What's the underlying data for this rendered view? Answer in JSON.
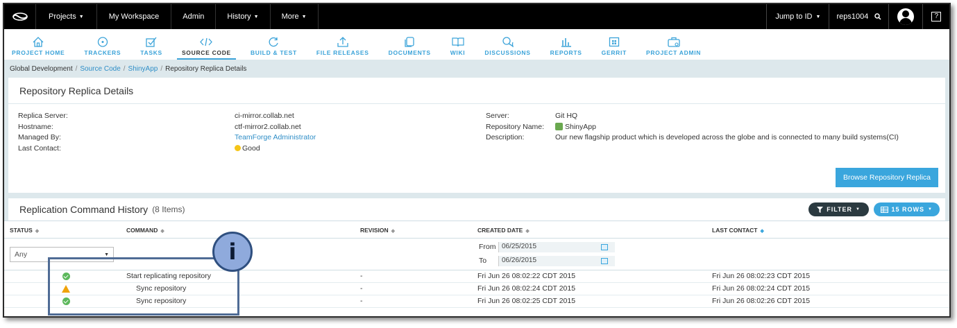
{
  "topbar": {
    "items": [
      "Projects",
      "My Workspace",
      "Admin",
      "History",
      "More"
    ],
    "jump_label": "Jump to ID",
    "search_value": "reps1004",
    "help_label": "?",
    "icons": {
      "logo": "collabnet-logo-icon",
      "search": "search-icon",
      "user": "user-avatar-icon"
    }
  },
  "toolnav": [
    {
      "label": "PROJECT HOME",
      "icon": "home-icon"
    },
    {
      "label": "TRACKERS",
      "icon": "target-icon"
    },
    {
      "label": "TASKS",
      "icon": "checkbox-icon"
    },
    {
      "label": "SOURCE CODE",
      "icon": "code-icon"
    },
    {
      "label": "BUILD & TEST",
      "icon": "refresh-icon"
    },
    {
      "label": "FILE RELEASES",
      "icon": "upload-icon"
    },
    {
      "label": "DOCUMENTS",
      "icon": "documents-icon"
    },
    {
      "label": "WIKI",
      "icon": "book-icon"
    },
    {
      "label": "DISCUSSIONS",
      "icon": "chat-icon"
    },
    {
      "label": "REPORTS",
      "icon": "bar-chart-icon"
    },
    {
      "label": "GERRIT",
      "icon": "gerrit-icon"
    },
    {
      "label": "PROJECT ADMIN",
      "icon": "briefcase-icon"
    }
  ],
  "breadcrumb": {
    "root": "Global Development",
    "sep": "/",
    "link1": "Source Code",
    "link2": "ShinyApp",
    "current": "Repository Replica Details"
  },
  "details": {
    "title": "Repository Replica Details",
    "labels_left": [
      "Replica Server:",
      "Hostname:",
      "Managed By:",
      "Last Contact:"
    ],
    "replica_server": "ci-mirror.collab.net",
    "hostname": "ctf-mirror2.collab.net",
    "managed_by": "TeamForge Administrator",
    "last_contact": "Good",
    "labels_right": [
      "Server:",
      "Repository Name:",
      "Description:"
    ],
    "server": "Git HQ",
    "repository_name": "ShinyApp",
    "description": "Our new flagship product which is developed across the globe and is connected to many build systems(CI)",
    "browse_button": "Browse Repository Replica"
  },
  "history": {
    "title": "Replication Command History",
    "count": "(8 Items)",
    "filter_button": "FILTER",
    "rows_button": "15 ROWS",
    "columns": [
      "STATUS",
      "COMMAND",
      "REVISION",
      "CREATED DATE",
      "LAST CONTACT"
    ],
    "status_filter": "Any",
    "from_label": "From",
    "from_value": "06/25/2015",
    "to_label": "To",
    "to_value": "06/26/2015",
    "rows": [
      {
        "status": "ok",
        "command": "Start replicating repository",
        "revision": "-",
        "created": "Fri Jun 26 08:02:22 CDT 2015",
        "last_contact": "Fri Jun 26 08:02:23 CDT 2015"
      },
      {
        "status": "warning",
        "command": "Sync repository",
        "revision": "-",
        "created": "Fri Jun 26 08:02:24 CDT 2015",
        "last_contact": "Fri Jun 26 08:02:24 CDT 2015"
      },
      {
        "status": "ok",
        "command": "Sync repository",
        "revision": "-",
        "created": "Fri Jun 26 08:02:25 CDT 2015",
        "last_contact": "Fri Jun 26 08:02:26 CDT 2015"
      }
    ]
  },
  "callout": {
    "label": "i"
  },
  "colors": {
    "accent": "#3aa6dd",
    "ok": "#5cb85c",
    "warning": "#f0a30a",
    "callout": "#8faadc"
  }
}
